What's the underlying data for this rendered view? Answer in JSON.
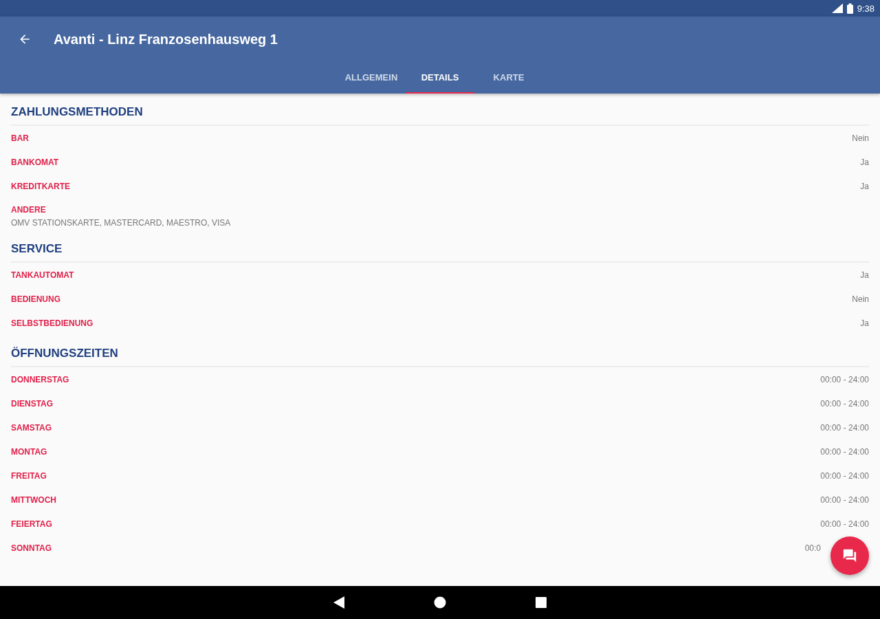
{
  "status_bar": {
    "time": "9:38"
  },
  "app_bar": {
    "title": "Avanti - Linz Franzosenhausweg 1"
  },
  "tabs": [
    {
      "label": "ALLGEMEIN",
      "selected": false
    },
    {
      "label": "DETAILS",
      "selected": true
    },
    {
      "label": "KARTE",
      "selected": false
    }
  ],
  "sections": [
    {
      "title": "ZAHLUNGSMETHODEN",
      "rows": [
        {
          "kind": "pair",
          "label": "BAR",
          "value": "Nein"
        },
        {
          "kind": "pair",
          "label": "BANKOMAT",
          "value": "Ja"
        },
        {
          "kind": "pair",
          "label": "KREDITKARTE",
          "value": "Ja"
        },
        {
          "kind": "note",
          "label": "ANDERE",
          "value": "OMV STATIONSKARTE, MASTERCARD, MAESTRO, VISA"
        }
      ]
    },
    {
      "title": "SERVICE",
      "rows": [
        {
          "kind": "pair",
          "label": "TANKAUTOMAT",
          "value": "Ja"
        },
        {
          "kind": "pair",
          "label": "BEDIENUNG",
          "value": "Nein"
        },
        {
          "kind": "pair",
          "label": "SELBSTBEDIENUNG",
          "value": "Ja"
        }
      ]
    },
    {
      "title": "ÖFFNUNGSZEITEN",
      "rows": [
        {
          "kind": "pair",
          "label": "DONNERSTAG",
          "value": "00:00 - 24:00"
        },
        {
          "kind": "pair",
          "label": "DIENSTAG",
          "value": "00:00 - 24:00"
        },
        {
          "kind": "pair",
          "label": "SAMSTAG",
          "value": "00:00 - 24:00"
        },
        {
          "kind": "pair",
          "label": "MONTAG",
          "value": "00:00 - 24:00"
        },
        {
          "kind": "pair",
          "label": "FREITAG",
          "value": "00:00 - 24:00"
        },
        {
          "kind": "pair",
          "label": "MITTWOCH",
          "value": "00:00 - 24:00"
        },
        {
          "kind": "pair",
          "label": "FEIERTAG",
          "value": "00:00 - 24:00"
        },
        {
          "kind": "pair",
          "label": "SONNTAG",
          "value": "00:0"
        }
      ]
    }
  ]
}
